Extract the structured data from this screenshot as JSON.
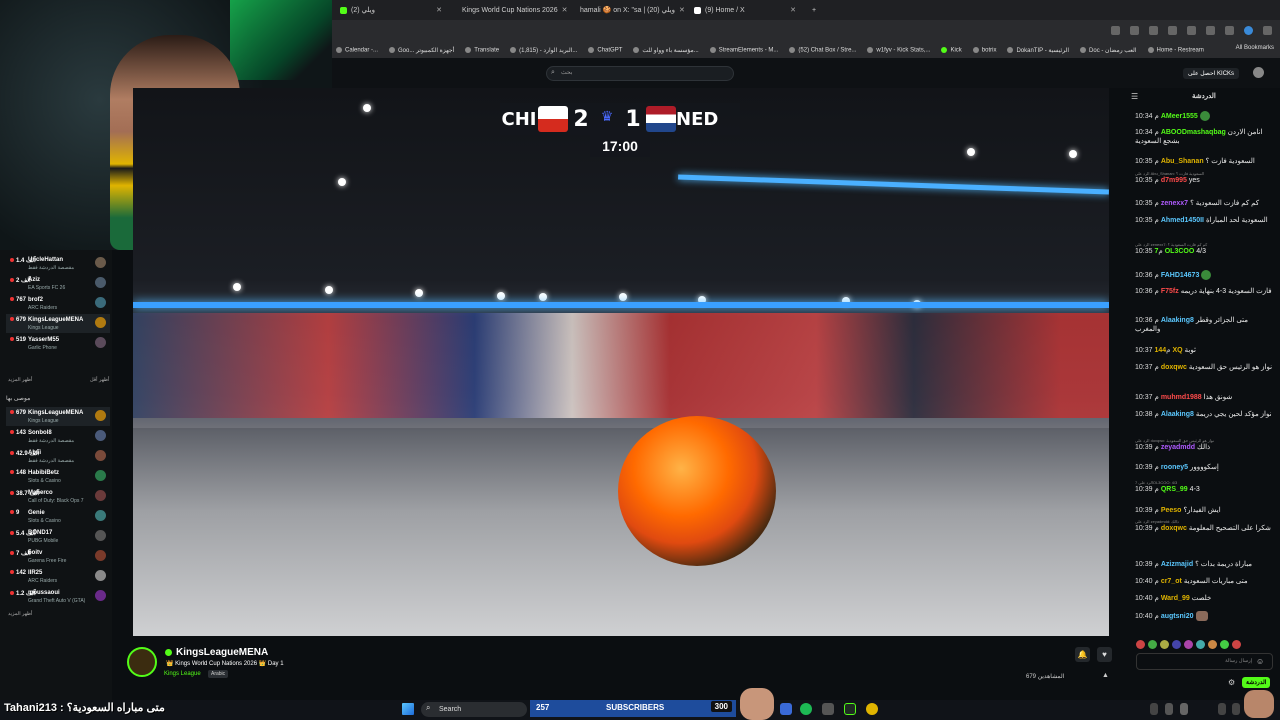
{
  "browser": {
    "tabs": [
      {
        "label": "(2) ويلي",
        "color": "#53fc18"
      },
      {
        "label": "Kings World Cup Nations 2026",
        "color": "#e0b400"
      },
      {
        "label": "hamali 🍪 on X: \"sa | ويلي (20)",
        "color": "#ffffff"
      },
      {
        "label": "(9) Home / X",
        "color": "#ffffff"
      }
    ],
    "bookmarks": [
      "Calendar -...",
      "Goo... أجهزة الكمبيوتر",
      "Translate",
      "البريد الوارد - (1,815)...",
      "ChatGPT",
      "مؤسسة باء وواو للت...",
      "StreamElements - M...",
      "(52) Chat Box / Stre...",
      "w1fyv - Kick Stats,...",
      "Kick",
      "botrix",
      "DokanTIP - الرئيسية",
      "Doc - العب رمضان",
      "Home - Restream"
    ],
    "all_bookmarks": "All Bookmarks"
  },
  "kick": {
    "search_placeholder": "بحث",
    "get_kicks": "احصل على KICKs"
  },
  "sidebar": {
    "channels": [
      {
        "count": "1.4 آلف",
        "name": "UncleHattan",
        "game": "مقصصة الدردشة فقط",
        "color": "#6a5a4a"
      },
      {
        "count": "2 آلف",
        "name": "Aziz",
        "game": "EA Sports FC 26",
        "color": "#4a5a6a"
      },
      {
        "count": "767",
        "name": "brof2",
        "game": "ARC Raiders",
        "color": "#3a6a7a"
      },
      {
        "count": "679",
        "name": "KingsLeagueMENA",
        "game": "Kings League",
        "color": "#b07a10"
      },
      {
        "count": "519",
        "name": "YasserM55",
        "game": "Garlic Phone",
        "color": "#5a4a5a"
      }
    ],
    "show_more": "أظهر المزيد",
    "show_less": "أظهر أقل",
    "section_title": "موصى بها",
    "recommended": [
      {
        "count": "679",
        "name": "KingsLeagueMENA",
        "game": "Kings League",
        "color": "#b07a10"
      },
      {
        "count": "143",
        "name": "Sonbol8",
        "game": "مقصصة الدردشة فقط",
        "color": "#4a5a7a"
      },
      {
        "count": "42.9 آلف",
        "name": "Absi",
        "game": "مقصصة الدردشة فقط",
        "color": "#7a4a3a"
      },
      {
        "count": "148",
        "name": "HabibiBetz",
        "game": "Slots & Casino",
        "color": "#2a7a4a"
      },
      {
        "count": "38.7 آلف",
        "name": "Maherco",
        "game": "Call of Duty: Black Ops 7",
        "color": "#6a3a3a"
      },
      {
        "count": "9",
        "name": "Genie",
        "game": "Slots & Casino",
        "color": "#3a7a7a"
      },
      {
        "count": "5.4 آلف",
        "name": "BOND17",
        "game": "PUBG Mobile",
        "color": "#555555"
      },
      {
        "count": "7 آلف",
        "name": "boitv",
        "game": "Garena Free Fire",
        "color": "#7a3a2a"
      },
      {
        "count": "142",
        "name": "IIR25",
        "game": "ARC Raiders",
        "color": "#8a8a8a"
      },
      {
        "count": "1.2 آلف",
        "name": "moussaoui",
        "game": "Grand Theft Auto V (GTA)",
        "color": "#6a2a8a"
      }
    ],
    "show_more_2": "أظهر المزيد"
  },
  "video": {
    "home_team": "CHI",
    "home_score": "2",
    "away_score": "1",
    "away_team": "NED",
    "clock": "17:00"
  },
  "channel": {
    "name": "KingsLeagueMENA",
    "title": "👑 Kings World Cup Nations 2026 👑 Day 1",
    "category": "Kings League",
    "language": "Arabic",
    "viewers": "679 المشاهدين"
  },
  "chat": {
    "title": "الدردشة",
    "messages": [
      {
        "time": "10:34 م",
        "user": "AMeer1555",
        "text": "",
        "color": "#53fc18"
      },
      {
        "time": "10:34 م",
        "user": "ABOODmashaqbag",
        "text": "انامن الاردن بشجع السعودية",
        "color": "#53fc18"
      },
      {
        "time": "10:35 م",
        "user": "Abu_Shanan",
        "text": "السعودية فازت ؟",
        "color": "#e0b400"
      },
      {
        "time": "10:35 م",
        "user": "d7m995",
        "text": "yes",
        "color": "#ff4b4b",
        "reply": "الرد على Abu_Shanan: السعودية فازت ؟"
      },
      {
        "time": "10:35 م",
        "user": "zenexx7",
        "text": "كم كم فازت السعودية ؟",
        "color": "#b05bff"
      },
      {
        "time": "10:35 م",
        "user": "Ahmed1450II",
        "text": "السعودية لحد المباراة",
        "color": "#5bc8ff"
      },
      {
        "time": "10:35 م",
        "user": "7OL3COO",
        "text": "4/3",
        "color": "#53fc18",
        "reply": "الرد على zenexx7: كم كم فازت السعودية ؟"
      },
      {
        "time": "10:36 م",
        "user": "FAHD14673",
        "text": "",
        "color": "#5bc8ff"
      },
      {
        "time": "10:36 م",
        "user": "F75fz",
        "text": "فازت السعودية 3-4 بنهاية دريمه",
        "color": "#ff4b4b"
      },
      {
        "time": "10:36 م",
        "user": "Alaaking8",
        "text": "متى الجزائر وقطر والمغرب",
        "color": "#5bc8ff"
      },
      {
        "time": "10:37 م",
        "user": "144XQ",
        "text": "ثوبة",
        "color": "#e0b400"
      },
      {
        "time": "10:37 م",
        "user": "doxqwc",
        "text": "نواز هو الرئيس حق السعودية",
        "color": "#e0b400"
      },
      {
        "time": "10:37 م",
        "user": "muhmd1988",
        "text": "شونق هذا",
        "color": "#ff4b4b"
      },
      {
        "time": "10:38 م",
        "user": "Alaaking8",
        "text": "نواز مؤكد لحين يجي دريمة",
        "color": "#5bc8ff"
      },
      {
        "time": "10:39 م",
        "user": "zeyadmdd",
        "text": "ذالك",
        "color": "#b05bff",
        "reply": "الرد على doxqwc: نواز هو الرئيس حق السعودية"
      },
      {
        "time": "10:39 م",
        "user": "rooney5",
        "text": "إسكوووور",
        "color": "#5bc8ff"
      },
      {
        "time": "10:39 م",
        "user": "QRS_99",
        "text": "4-3",
        "color": "#53fc18",
        "reply": "الرد على 7OL3COO: 4/3"
      },
      {
        "time": "10:39 م",
        "user": "Peeso",
        "text": "ايش الفيدار؟",
        "color": "#e0b400"
      },
      {
        "time": "10:39 م",
        "user": "doxqwc",
        "text": "شكرا على التصحيح المعلومة",
        "color": "#e0b400",
        "reply": "الرد على zeyadmdd: ذالك"
      },
      {
        "time": "10:39 م",
        "user": "Azizmajid",
        "text": "مباراة دريمة بدات ؟",
        "color": "#5bc8ff"
      },
      {
        "time": "10:40 م",
        "user": "cr7_ot",
        "text": "متى مباريات السعودية",
        "color": "#e0b400"
      },
      {
        "time": "10:40 م",
        "user": "Ward_99",
        "text": "خلصت",
        "color": "#e0b400"
      },
      {
        "time": "10:40 م",
        "user": "augtsni20",
        "text": "",
        "color": "#5bc8ff"
      }
    ],
    "input_placeholder": "إرسال رسالة",
    "send_label": "الدردشة"
  },
  "overlay": {
    "question": "Tahani213 : متى مباراه السعودية؟"
  },
  "taskbar": {
    "search_label": "Search",
    "subs_count": "257",
    "subs_label": "SUBSCRIBERS",
    "subs_goal": "300"
  }
}
